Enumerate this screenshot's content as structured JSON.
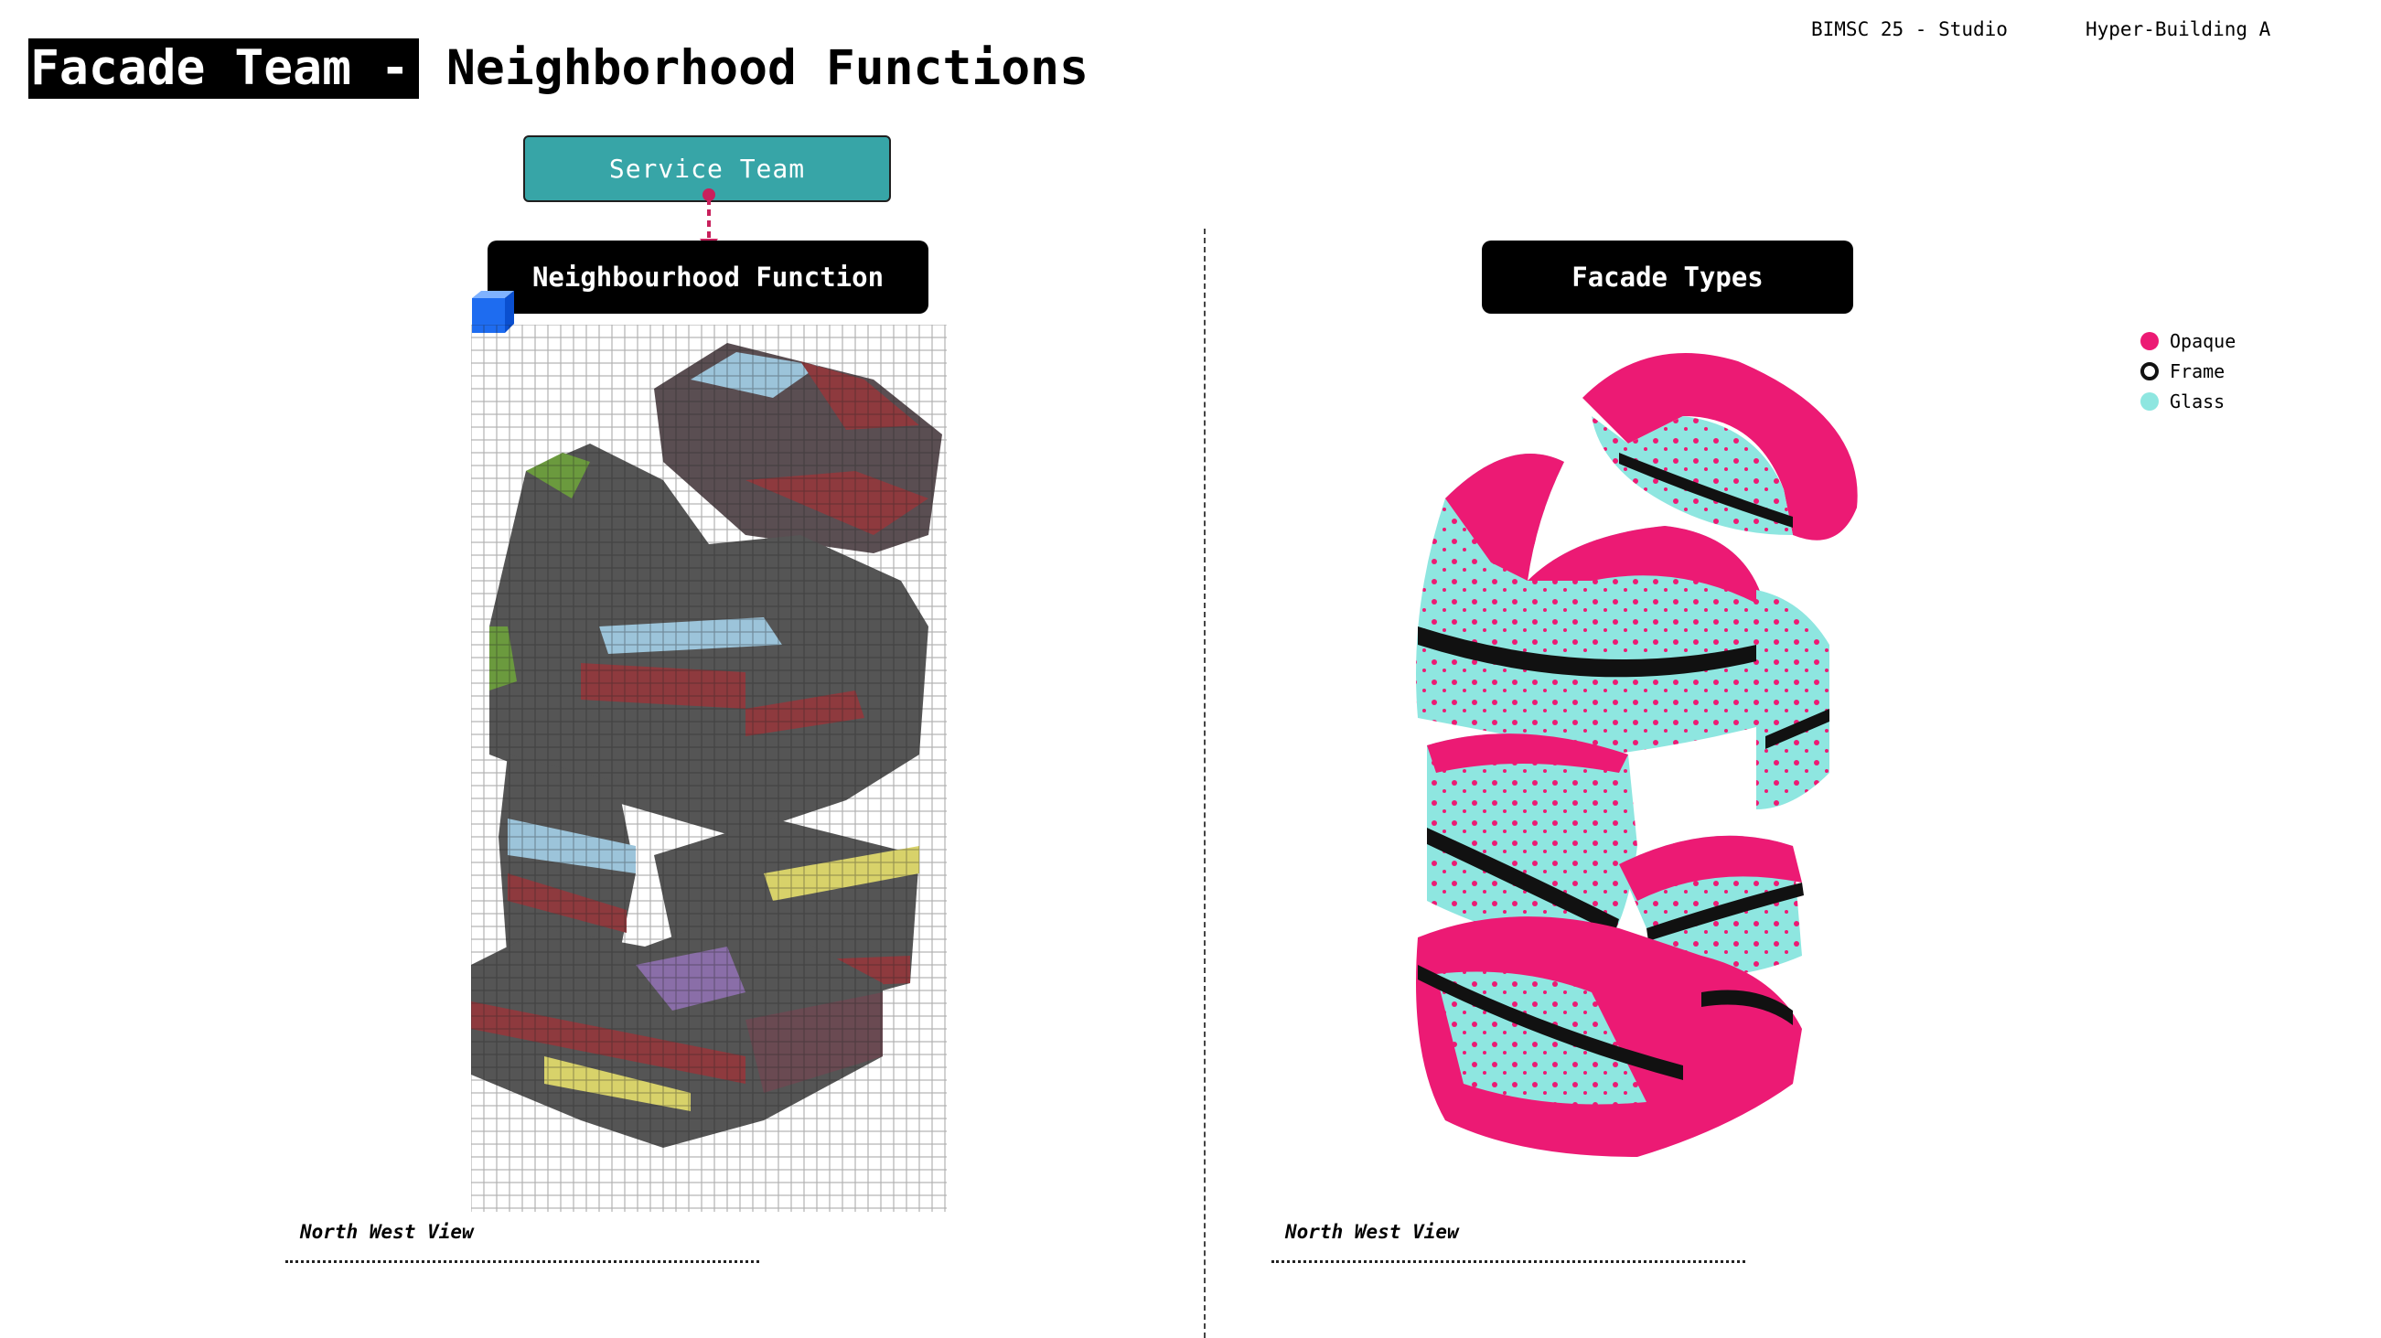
{
  "header": {
    "title_highlight": "Facade Team -",
    "title_rest": "Neighborhood Functions",
    "course": "BIMSC 25 - Studio",
    "project": "Hyper-Building A"
  },
  "left_panel": {
    "service_box": "Service Team",
    "section_title": "Neighbourhood Function",
    "view_label": "North West View"
  },
  "right_panel": {
    "section_title": "Facade Types",
    "view_label": "North West View",
    "legend": [
      {
        "label": "Opaque",
        "color": "#ec1a74",
        "style": "filled"
      },
      {
        "label": "Frame",
        "color": "#111111",
        "style": "ring"
      },
      {
        "label": "Glass",
        "color": "#8ee6e0",
        "style": "filled"
      }
    ]
  },
  "colors": {
    "accent_teal": "#37a5a7",
    "arrow_pink": "#c8205c",
    "voxel_dark": "#555555",
    "voxel_red": "#8e3a3e",
    "opaque_pink": "#ec1a74",
    "glass_cyan": "#8ee6e0"
  }
}
